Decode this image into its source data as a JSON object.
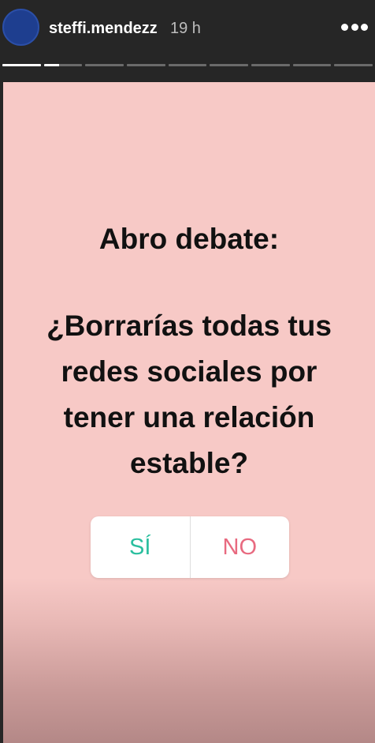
{
  "header": {
    "username": "steffi.mendezz",
    "timestamp": "19 h",
    "avatar_color": "#1e3e8f"
  },
  "progress": {
    "segments": 9,
    "completed": 1,
    "current_fraction": 0.4
  },
  "story": {
    "background": "#f7c9c6",
    "title": "Abro debate:",
    "question_lines": [
      "¿Borrarías todas tus",
      "redes sociales por",
      "tener una relación",
      "estable?"
    ],
    "poll": {
      "yes_label": "SÍ",
      "no_label": "NO",
      "yes_color": "#2bbf9f",
      "no_color": "#e86a80"
    }
  }
}
